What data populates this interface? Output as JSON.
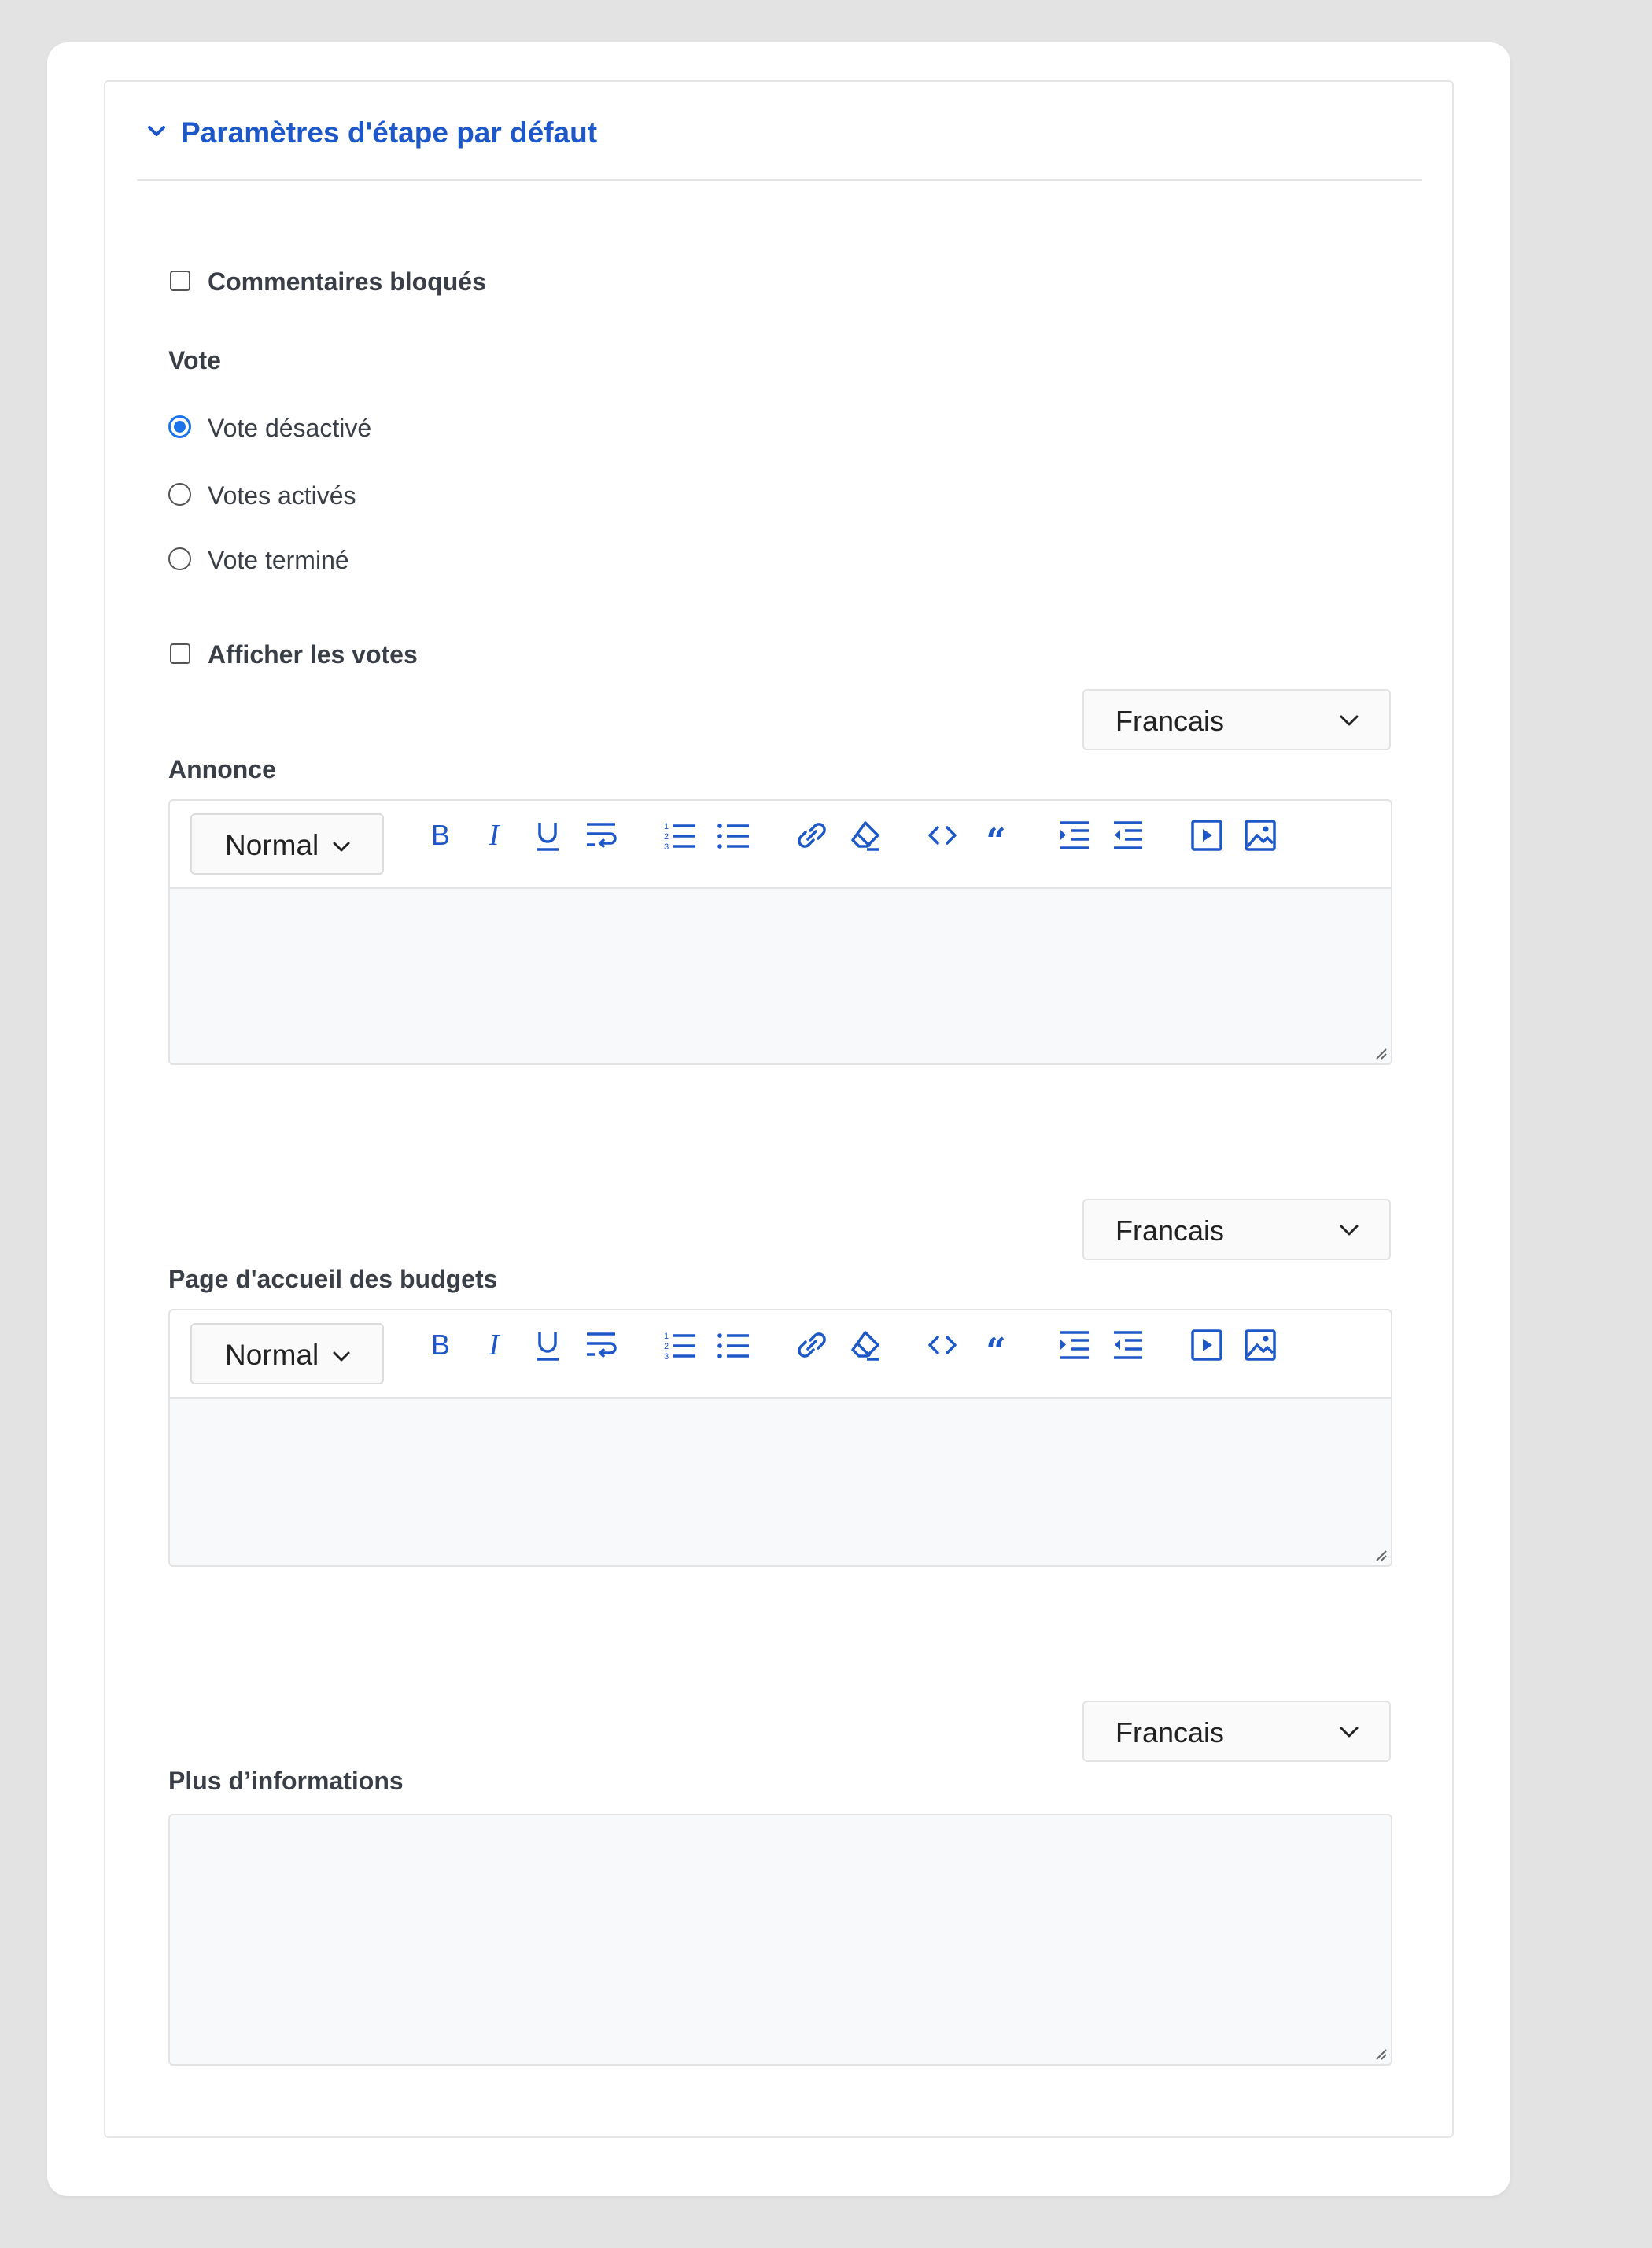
{
  "section": {
    "title": "Paramètres d'étape par défaut"
  },
  "comments_locked": {
    "label": "Commentaires bloqués",
    "checked": false
  },
  "vote": {
    "heading": "Vote",
    "options": [
      {
        "label": "Vote désactivé",
        "selected": true
      },
      {
        "label": "Votes activés",
        "selected": false
      },
      {
        "label": "Vote terminé",
        "selected": false
      }
    ]
  },
  "show_votes": {
    "label": "Afficher les votes",
    "checked": false
  },
  "announcement": {
    "label": "Annonce",
    "language": "Francais",
    "format": "Normal",
    "content": ""
  },
  "budgets_home": {
    "label": "Page d'accueil des budgets",
    "language": "Francais",
    "format": "Normal",
    "content": ""
  },
  "more_info": {
    "label": "Plus d’informations",
    "language": "Francais",
    "content": ""
  },
  "toolbar_icons": [
    "bold-icon",
    "italic-icon",
    "underline-icon",
    "line-break-icon",
    "ordered-list-icon",
    "bullet-list-icon",
    "link-icon",
    "clear-format-icon",
    "code-icon",
    "blockquote-icon",
    "indent-icon",
    "outdent-icon",
    "video-icon",
    "image-icon"
  ],
  "colors": {
    "accent": "#1e58c8",
    "radio": "#1a73e8",
    "text": "#3a3f47"
  }
}
